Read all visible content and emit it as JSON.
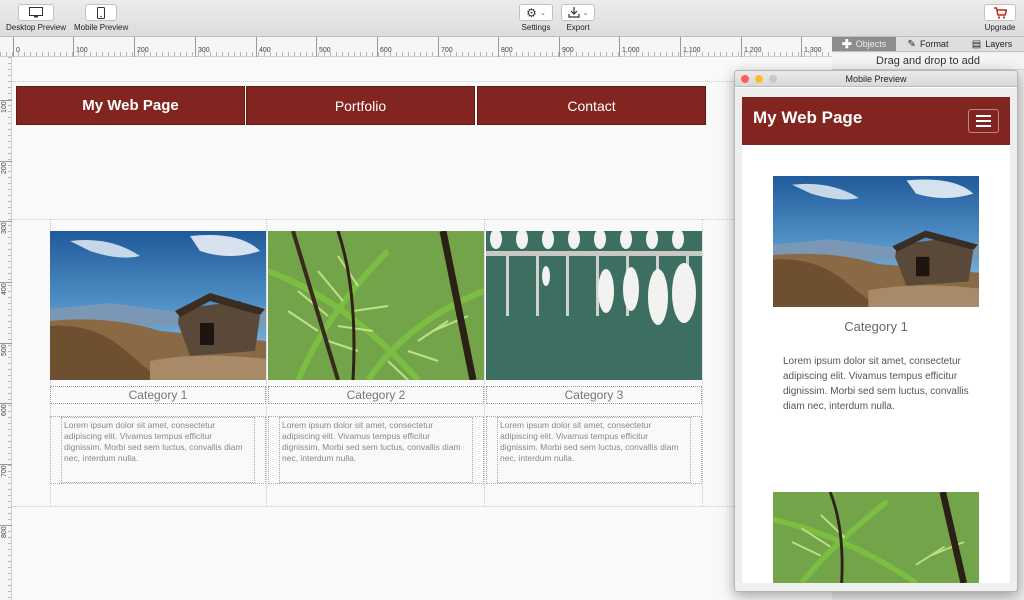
{
  "toolbar": {
    "desktop_preview": "Desktop Preview",
    "mobile_preview": "Mobile Preview",
    "settings": "Settings",
    "export": "Export",
    "upgrade": "Upgrade"
  },
  "panel": {
    "tabs": [
      "Objects",
      "Format",
      "Layers"
    ],
    "active_tab": "Objects",
    "drag_hint": "Drag and drop to add"
  },
  "rulers": {
    "top": [
      "0",
      "100",
      "200",
      "300",
      "400",
      "500",
      "600",
      "700",
      "800",
      "900",
      "1,000",
      "1,100",
      "1,200",
      "1,300"
    ],
    "left": [
      "100",
      "200",
      "300",
      "400",
      "500",
      "600",
      "700",
      "800"
    ]
  },
  "site": {
    "brand": "My Web Page",
    "nav": [
      "Portfolio",
      "Contact"
    ],
    "categories": [
      "Category 1",
      "Category 2",
      "Category 3"
    ],
    "lorem": "Lorem ipsum dolor sit amet, consectetur adipiscing elit. Vivamus tempus efficitur dignissim. Morbi sed sem luctus, convallis diam nec, interdum nulla."
  },
  "mobile_preview": {
    "window_title": "Mobile Preview",
    "brand": "My Web Page",
    "category": "Category 1",
    "text": "Lorem ipsum dolor sit amet, consectetur adipiscing elit. Vivamus tempus efficitur dignissim. Morbi sed sem luctus, convallis diam nec, interdum nulla."
  },
  "colors": {
    "brand": "#822520",
    "traffic_close": "#fc5f57",
    "traffic_min": "#fdbc2e",
    "traffic_max": "#c8c8c8"
  }
}
